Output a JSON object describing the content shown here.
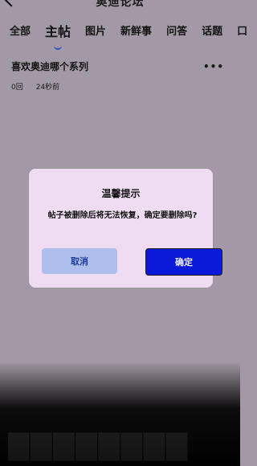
{
  "header": {
    "title": "奥迪论坛"
  },
  "tabs": [
    {
      "label": "全部",
      "active": false
    },
    {
      "label": "主帖",
      "active": true
    },
    {
      "label": "图片",
      "active": false
    },
    {
      "label": "新鲜事",
      "active": false
    },
    {
      "label": "问答",
      "active": false
    },
    {
      "label": "话题",
      "active": false
    },
    {
      "label": "口",
      "active": false
    }
  ],
  "post": {
    "title": "喜欢奥迪哪个系列",
    "replies": "0回",
    "time": "24秒前",
    "more_icon": "more-horizontal-icon"
  },
  "dialog": {
    "title": "温馨提示",
    "message": "帖子被删除后将无法恢复，确定要删除吗?",
    "cancel_label": "取消",
    "confirm_label": "确定"
  },
  "colors": {
    "background": "#a398a5",
    "dialog": "#efdcf3",
    "cancel_button": "#aebfee",
    "confirm_button": "#0b1ad8",
    "tab_indicator": "#1f4fbf"
  }
}
